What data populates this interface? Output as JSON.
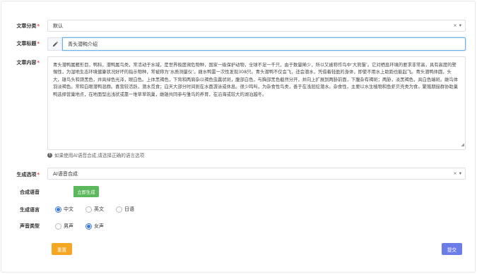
{
  "form": {
    "category": {
      "label": "文章分类",
      "required_mark": "*",
      "value": "默认",
      "clear_glyph": "×",
      "arrow_glyph": "▾"
    },
    "title": {
      "label": "文章标题",
      "required_mark": "*",
      "icon": "pencil-icon",
      "value": "青头潜鸭介绍"
    },
    "content": {
      "label": "文章内容",
      "required_mark": "*",
      "value": "青头潜鸭属雁形目，鸭科，潜鸭属鸟类，常活动于水域，是世界极度濒危物种，国家一级保护动物，全球不足一千只，由于数量稀少，所以又被称作鸟中‘大熊猫’。它对栖息环境的要求非常高，具有高度的警惕性，为湿地生态环境健康状况好坏的指示物种，常被称为‘水质测量仪’。雌水鸭雷一次性发现308只。青头潜鸭不仅会飞，还会潜水，凭借着轻盈的身体，即使不用水上助跑也能起飞。青头潜鸭体圆，头大，雄鸟头和颈黑色，并具绿色光泽，眼白色。上体黑褐色，下背和两肩杂以褐色虫蠹状斑，腹部白色，与胸部黑色截然分开，并向上扩展到两胁前面，下腹杂有褐斑；两胁，淡黑褐色，具白色端斑。雌鸟体羽淡褐色。常和白眼潜鸭混群。喜营较活跃，潜水觅食；白天大部分时间则在水面游泳或休息。很少鸣叫，为杂食性鸟类，善于在浅层挖潜水。杂食性，主要以水生植物和鱼虾贝壳类为食。繁殖期接群协助巢鸭选择营巢地点，在地面型出浅状或靠一堆草草筑巢，雌雄共同参与雏鸟的养育，在沿海或较大的湖泊越冬。",
      "resize_glyph": "◢",
      "help_icon": "info-icon",
      "help_icon_glyph": "!",
      "help_text": "如果使用AI语音合成,请选择正确的语言选项"
    },
    "generate_option": {
      "label": "生成选项",
      "required_mark": "*",
      "value": "AI语音合成",
      "clear_glyph": "×",
      "arrow_glyph": "▾"
    },
    "synth_voice": {
      "label": "合成语音",
      "button_label": "立即生成"
    },
    "language": {
      "label": "生成语言",
      "options": [
        "中文",
        "英文",
        "日语"
      ],
      "selected": "中文"
    },
    "voice_type": {
      "label": "声音类型",
      "options": [
        "男声",
        "女声"
      ],
      "selected": "女声"
    }
  },
  "actions": {
    "reset_label": "重置",
    "submit_label": "提交"
  },
  "colors": {
    "required": "#e4393c",
    "generate_button": "#5cb85c",
    "reset_button": "#f5a623",
    "submit_button": "#6d7de8",
    "radio_checked": "#3b76e1",
    "focus_border": "#66afe9"
  }
}
